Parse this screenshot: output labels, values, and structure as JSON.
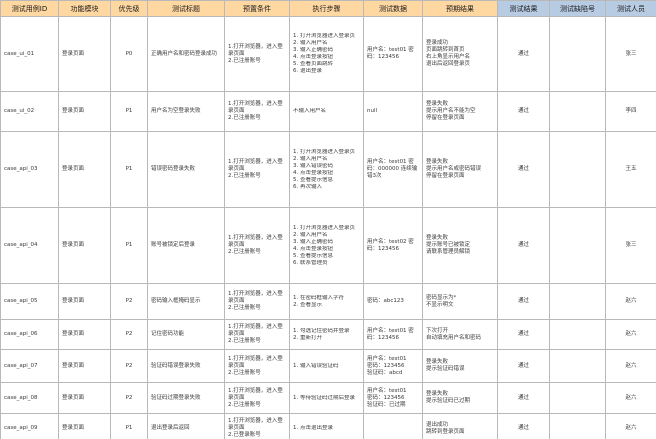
{
  "headers": [
    {
      "label": "测试用例ID",
      "color": "orange"
    },
    {
      "label": "功能模块",
      "color": "orange"
    },
    {
      "label": "优先级",
      "color": "orange"
    },
    {
      "label": "测试标题",
      "color": "orange"
    },
    {
      "label": "预置条件",
      "color": "orange"
    },
    {
      "label": "执行步骤",
      "color": "orange"
    },
    {
      "label": "测试数据",
      "color": "orange"
    },
    {
      "label": "预期结果",
      "color": "orange"
    },
    {
      "label": "测试结果",
      "color": "blue"
    },
    {
      "label": "测试缺陷号",
      "color": "blue"
    },
    {
      "label": "测试人员",
      "color": "blue"
    }
  ],
  "rows": [
    {
      "id": "case_ui_01",
      "module": "登录页面",
      "priority": "P0",
      "title": "正确用户名和密码登录成功",
      "precondition": "1.打开浏览器，进入登录页面\n2.已注册账号",
      "steps": [
        "1. 打开浏览器进入登录页",
        "2. 输入用户名",
        "3. 输入正确密码",
        "4. 点击登录按钮",
        "5. 查看页面跳转",
        "6. 退出登录"
      ],
      "data": "用户名：test01 密码：123456",
      "expected": "登录成功\n页面跳转到首页\n右上角显示用户名\n退出后返回登录页",
      "result": "通过",
      "bug": "",
      "tester": "张三"
    },
    {
      "id": "case_ui_02",
      "module": "登录页面",
      "priority": "P1",
      "title": "用户名为空登录失败",
      "precondition": "1.打开浏览器，进入登录页面\n2.已注册账号",
      "steps": [
        "不输入用户名"
      ],
      "data": "null",
      "expected": "登录失败\n提示用户名不能为空\n停留在登录页面",
      "result": "通过",
      "bug": "",
      "tester": "李四"
    },
    {
      "id": "case_api_03",
      "module": "登录页面",
      "priority": "P1",
      "title": "错误密码登录失败",
      "precondition": "1.打开浏览器，进入登录页面\n2.已注册账号",
      "steps": [
        "1. 打开浏览器进入登录页",
        "2. 输入用户名",
        "3. 输入错误密码",
        "4. 点击登录按钮",
        "5. 查看提示信息",
        "6. 再次输入"
      ],
      "data": "用户名：test01 密码：000000 连续输错3次",
      "expected": "登录失败\n提示用户名或密码错误\n停留在登录页面",
      "result": "通过",
      "bug": "",
      "tester": "王五"
    },
    {
      "id": "case_api_04",
      "module": "登录页面",
      "priority": "P1",
      "title": "账号被锁定后登录",
      "precondition": "1.打开浏览器，进入登录页面\n2.已注册账号",
      "steps": [
        "1. 打开浏览器进入登录页",
        "2. 输入用户名",
        "3. 输入正确密码",
        "4. 点击登录按钮",
        "5. 查看提示信息",
        "6. 联系管理员"
      ],
      "data": "用户名：test02 密码：123456",
      "expected": "登录失败\n提示账号已被锁定\n请联系管理员解锁",
      "result": "通过",
      "bug": "",
      "tester": "张三"
    },
    {
      "id": "case_api_05",
      "module": "登录页面",
      "priority": "P2",
      "title": "密码输入框掩码显示",
      "precondition": "1.打开浏览器，进入登录页面\n2.已注册账号",
      "steps": [
        "1. 在密码框输入字符",
        "2. 查看显示"
      ],
      "data": "密码：abc123",
      "expected": "密码显示为*\n不显示明文",
      "result": "通过",
      "bug": "",
      "tester": "赵六"
    },
    {
      "id": "case_api_06",
      "module": "登录页面",
      "priority": "P2",
      "title": "记住密码功能",
      "precondition": "1.打开浏览器，进入登录页面\n2.已注册账号",
      "steps": [
        "1. 勾选记住密码并登录",
        "2. 重新打开"
      ],
      "data": "用户名：test01 密码：123456",
      "expected": "下次打开\n自动填充用户名和密码",
      "result": "通过",
      "bug": "",
      "tester": "赵六"
    },
    {
      "id": "case_api_07",
      "module": "登录页面",
      "priority": "P2",
      "title": "验证码错误登录失败",
      "precondition": "1.打开浏览器，进入登录页面\n2.已注册账号",
      "steps": [
        "1. 输入错误验证码"
      ],
      "data": "用户名：test01\n密码：123456\n验证码：abcd",
      "expected": "登录失败\n提示验证码错误",
      "result": "通过",
      "bug": "",
      "tester": "赵六"
    },
    {
      "id": "case_api_08",
      "module": "登录页面",
      "priority": "P2",
      "title": "验证码过期登录失败",
      "precondition": "1.打开浏览器，进入登录页面\n2.已注册账号",
      "steps": [
        "1. 等待验证码过期后登录"
      ],
      "data": "用户名：test01\n密码：123456\n验证码：已过期",
      "expected": "登录失败\n提示验证码已过期",
      "result": "通过",
      "bug": "",
      "tester": "赵六"
    },
    {
      "id": "case_api_09",
      "module": "登录页面",
      "priority": "P1",
      "title": "退出登录后返回",
      "precondition": "1.打开浏览器，进入登录页面\n2.已登录账号",
      "steps": [
        "1. 点击退出登录"
      ],
      "data": "",
      "expected": "退出成功\n跳转到登录页面",
      "result": "通过",
      "bug": "",
      "tester": "赵六"
    }
  ]
}
